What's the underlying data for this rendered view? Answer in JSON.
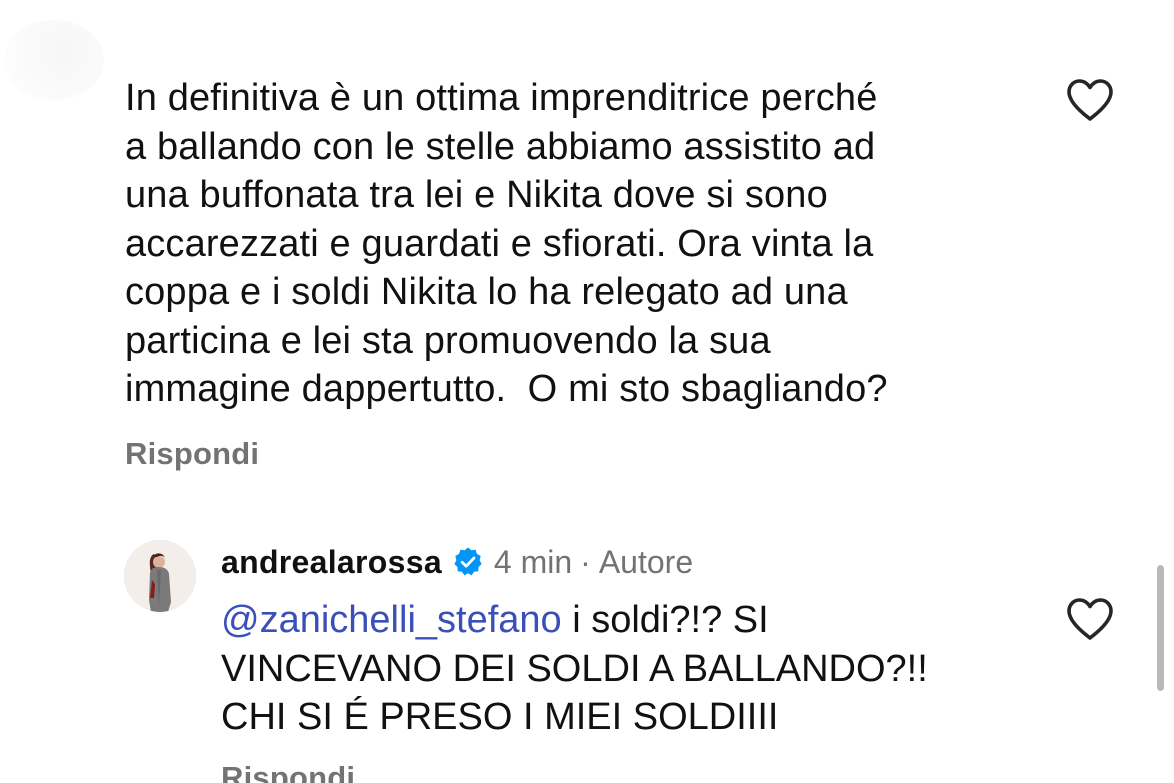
{
  "comment": {
    "text": "In definitiva è un ottima imprenditrice perché\na ballando con le stelle abbiamo assistito ad\nuna buffonata tra lei e Nikita dove si sono\naccarezzati e guardati e sfiorati. Ora vinta la\ncoppa e i soldi Nikita lo ha relegato ad una\nparticina e lei sta promuovendo la sua\nimmagine dappertutto.  O mi sto sbagliando?",
    "reply_label": "Rispondi",
    "like_icon": "heart-outline-icon"
  },
  "reply": {
    "username": "andrealarossa",
    "verified_icon": "verified-badge-icon",
    "verified_color": "#0095f6",
    "time": "4 min",
    "separator": "·",
    "role": "Autore",
    "mention": "@zanichelli_stefano",
    "text_line1_rest": " i soldi?!? SI",
    "text_line2": "VINCEVANO DEI SOLDI A BALLANDO?!!",
    "text_line3": "CHI SI É PRESO I MIEI SOLDIIII",
    "reply_label": "Rispondi",
    "like_icon": "heart-outline-icon"
  },
  "colors": {
    "text": "#111111",
    "muted": "#737373",
    "mention": "#3b4fb8"
  }
}
